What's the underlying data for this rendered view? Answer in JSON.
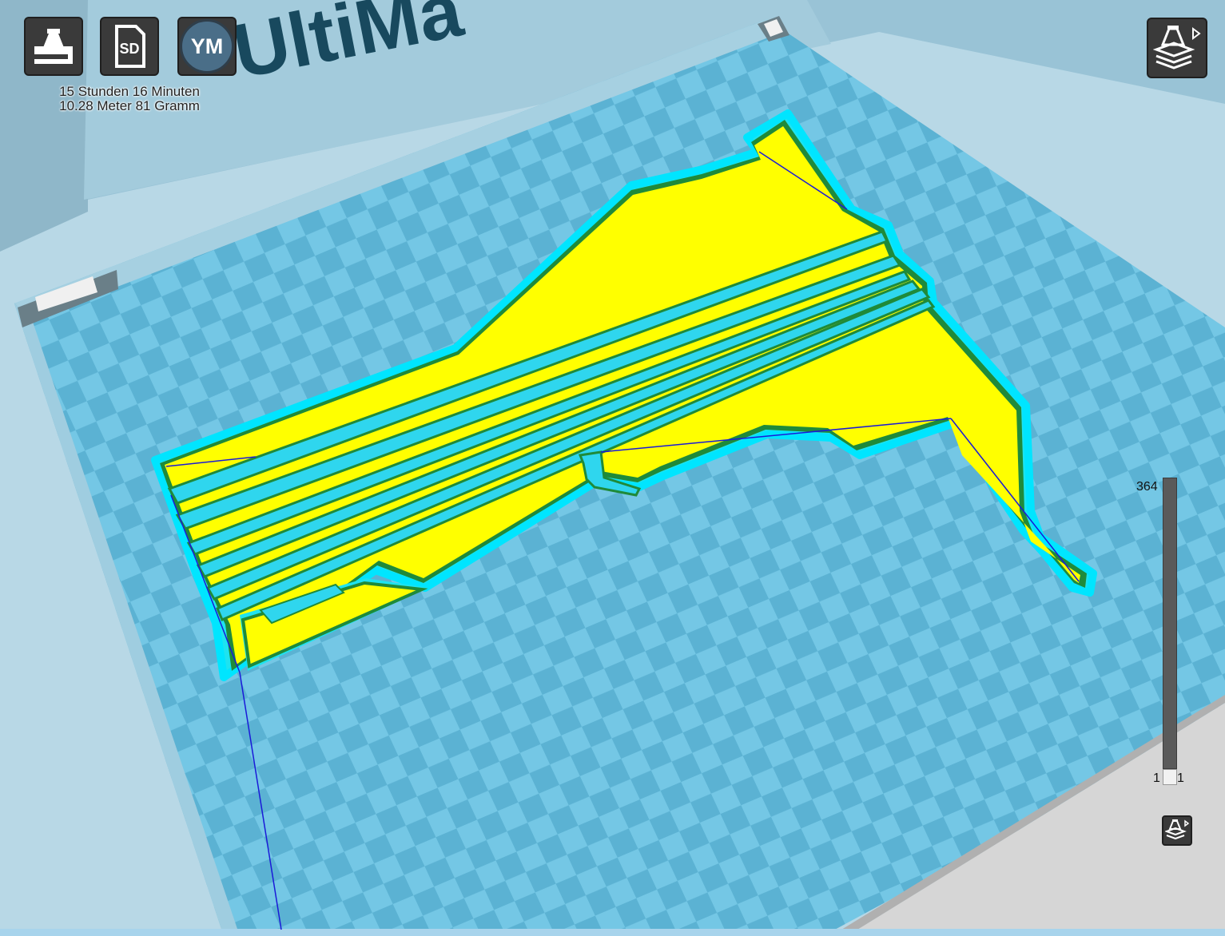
{
  "toolbar": {
    "load_icon": "printer-load-icon",
    "sd_label": "SD",
    "sd_icon": "sd-card-icon",
    "youmagine_label": "YM",
    "view_mode_icon": "layer-view-icon"
  },
  "print_info": {
    "time": "15 Stunden 16 Minuten",
    "material": "10.28 Meter 81 Gramm"
  },
  "scene": {
    "bed_brand_text": "UltiMa",
    "colors": {
      "checker_light": "#74c7e5",
      "checker_dark": "#5bb2d3",
      "outline_skirt": "#00e5ff",
      "infill": "#ffff00",
      "wall_outer": "#1f8a3a",
      "wall_inner": "#6fe000",
      "travel": "#1a1ad8"
    }
  },
  "layer_slider": {
    "max_label": "364",
    "min_label_left": "1",
    "min_label_right": "1",
    "current_layer": 1,
    "max_layer": 364
  }
}
